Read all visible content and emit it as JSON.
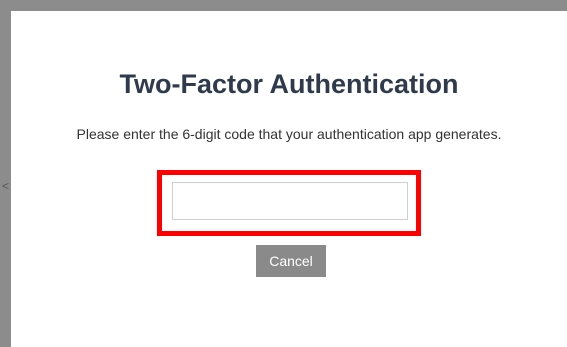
{
  "dialog": {
    "title": "Two-Factor Authentication",
    "instructions": "Please enter the 6-digit code that your authentication app generates.",
    "code_input": {
      "value": "",
      "placeholder": ""
    },
    "cancel_label": "Cancel"
  },
  "backdrop": {
    "edge_glyph": "<"
  },
  "colors": {
    "title": "#2f3b4c",
    "highlight": "#ff0000",
    "cancel_button": "#8a8a8a",
    "frame": "#8c8c8c"
  }
}
